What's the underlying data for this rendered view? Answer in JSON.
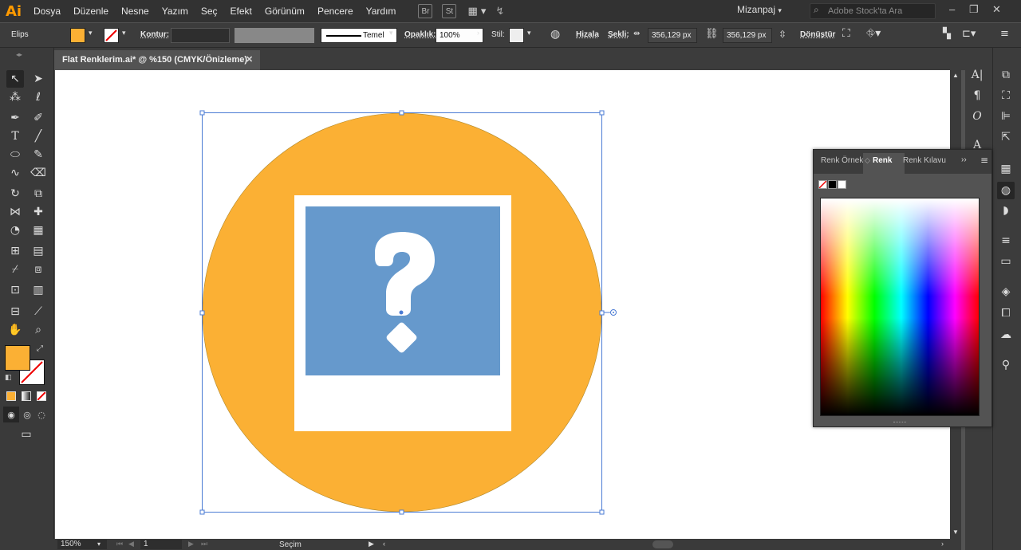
{
  "app": {
    "logo": "Ai"
  },
  "menu": [
    "Dosya",
    "Düzenle",
    "Nesne",
    "Yazım",
    "Seç",
    "Efekt",
    "Görünüm",
    "Pencere",
    "Yardım"
  ],
  "menubar_icons": {
    "br": "Br",
    "st": "St"
  },
  "workspace": "Mizanpaj",
  "search": {
    "placeholder": "Adobe Stock'ta Ara"
  },
  "control": {
    "object_type": "Elips",
    "stroke_label": "Kontur:",
    "brush_label": "Temel",
    "opacity_label": "Opaklık:",
    "opacity_value": "100%",
    "style_label": "Stil:",
    "align_label": "Hizala",
    "shape_label": "Şekli:",
    "width_value": "356,129 px",
    "height_value": "356,129 px",
    "transform_label": "Dönüştür"
  },
  "document": {
    "tab_title": "Flat Renklerim.ai* @ %150 (CMYK/Önizleme)"
  },
  "status": {
    "zoom": "150%",
    "artboard": "1",
    "mode": "Seçim"
  },
  "color_panel": {
    "tabs": [
      "Renk Örnek",
      "Renk",
      "Renk Kılavu"
    ]
  },
  "colors": {
    "fill": "#fbb034",
    "circle": "#fbb034",
    "photo_blue": "#6699cc",
    "selection": "#4a7bd4",
    "accent_logo": "#ff9a00"
  },
  "icons": {
    "question_mark": "question-mark-icon"
  }
}
